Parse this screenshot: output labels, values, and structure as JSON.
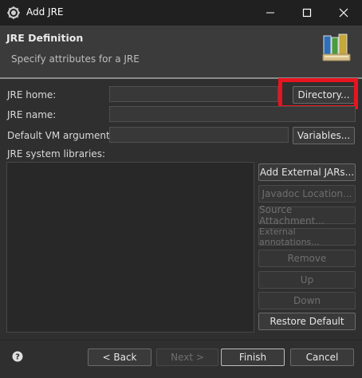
{
  "window": {
    "title": "Add JRE",
    "controls": [
      "minimize",
      "maximize",
      "close"
    ]
  },
  "header": {
    "title": "JRE Definition",
    "subtitle": "Specify attributes for a JRE"
  },
  "form": {
    "jre_home": {
      "label": "JRE home:",
      "value": ""
    },
    "jre_name": {
      "label": "JRE name:",
      "value": ""
    },
    "vm_args": {
      "label": "Default VM arguments:",
      "value": ""
    },
    "libraries_label": "JRE system libraries:"
  },
  "buttons": {
    "directory": "Directory...",
    "variables": "Variables...",
    "add_external_jars": "Add External JARs...",
    "javadoc_location": "Javadoc Location...",
    "source_attachment": "Source Attachment...",
    "external_annotations": "External annotations...",
    "remove": "Remove",
    "up": "Up",
    "down": "Down",
    "restore_default": "Restore Default"
  },
  "footer": {
    "back": "< Back",
    "next": "Next >",
    "finish": "Finish",
    "cancel": "Cancel"
  },
  "colors": {
    "highlight": "#e8141f",
    "background": "#2f2f2f"
  }
}
